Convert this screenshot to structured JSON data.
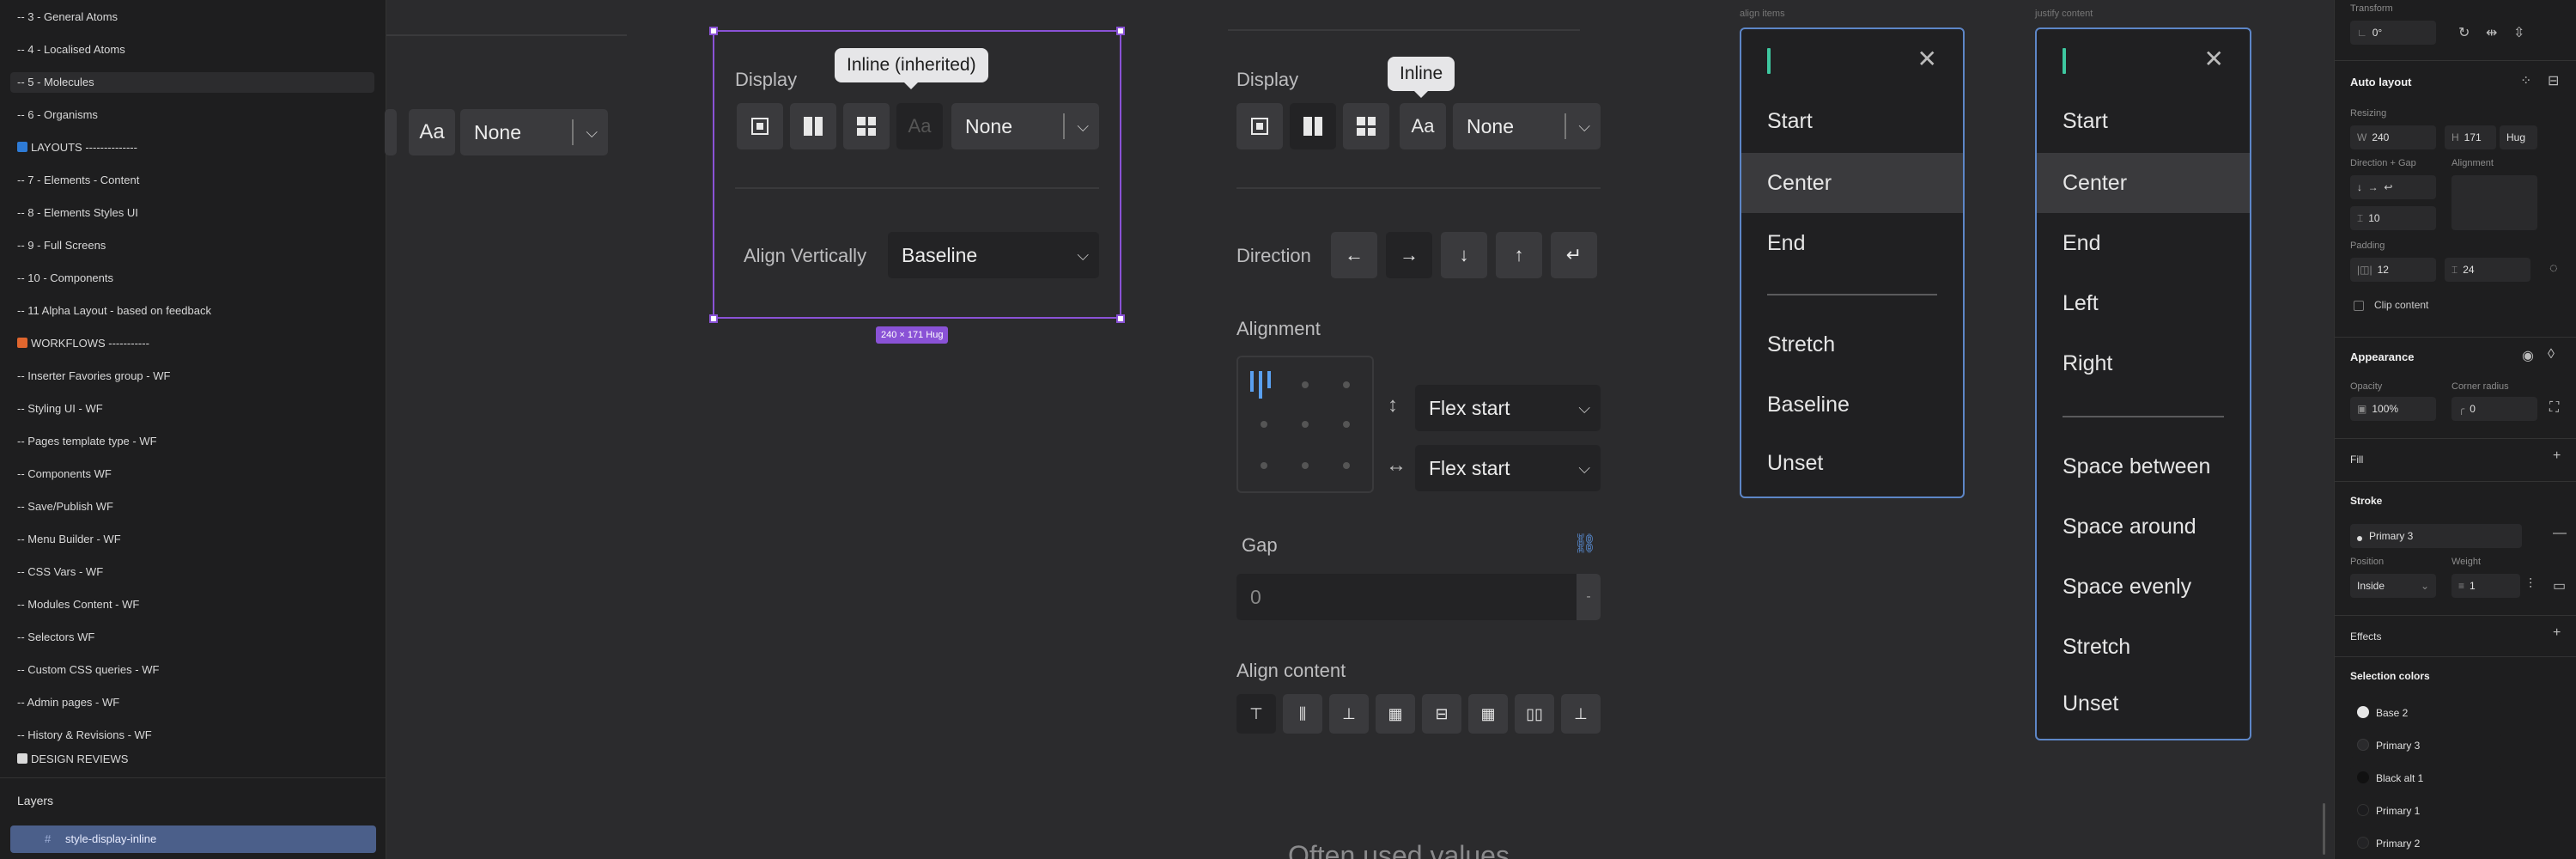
{
  "left_panel": {
    "pages": [
      {
        "label": "-- 3 - General Atoms"
      },
      {
        "label": "-- 4 - Localised Atoms"
      },
      {
        "label": "-- 5 - Molecules"
      },
      {
        "label": "-- 6 - Organisms"
      },
      {
        "label": "LAYOUTS --------------"
      },
      {
        "label": "-- 7 - Elements - Content"
      },
      {
        "label": "-- 8 - Elements Styles UI"
      },
      {
        "label": "-- 9 - Full Screens"
      },
      {
        "label": "-- 10 - Components"
      },
      {
        "label": "-- 11 Alpha Layout - based on feedback"
      },
      {
        "label": "WORKFLOWS -----------"
      },
      {
        "label": "-- Inserter Favories group - WF"
      },
      {
        "label": "-- Styling UI - WF"
      },
      {
        "label": "-- Pages template type - WF"
      },
      {
        "label": "-- Components WF"
      },
      {
        "label": "-- Save/Publish WF"
      },
      {
        "label": "-- Menu Builder - WF"
      },
      {
        "label": "-- CSS Vars - WF"
      },
      {
        "label": "-- Modules Content - WF"
      },
      {
        "label": "-- Selectors WF"
      },
      {
        "label": "-- Custom CSS queries - WF"
      },
      {
        "label": "-- Admin pages - WF"
      },
      {
        "label": "-- History & Revisions - WF"
      },
      {
        "label": "DESIGN REVIEWS"
      }
    ],
    "layers_label": "Layers",
    "selected_layer": "style-display-inline",
    "colors": {
      "layouts_icon": "#2e7bd6",
      "workflows_icon": "#e0662e",
      "design_icon": "#d9d9d9"
    }
  },
  "canvas": {
    "left_partial": {
      "aa": "Aa",
      "none": "None"
    },
    "frame1": {
      "display_label": "Display",
      "tooltip": "Inline (inherited)",
      "aa": "Aa",
      "none": "None",
      "align_label": "Align Vertically",
      "align_value": "Baseline",
      "size_badge": "240 × 171 Hug"
    },
    "frame2": {
      "display_label": "Display",
      "tooltip": "Inline",
      "aa": "Aa",
      "none": "None",
      "direction_label": "Direction",
      "alignment_label": "Alignment",
      "flex1": "Flex start",
      "flex2": "Flex start",
      "gap_label": "Gap",
      "gap_value": "0",
      "gap_unit": "-",
      "align_content_label": "Align content"
    },
    "align_items_dd": {
      "caption": "align items",
      "items": [
        "Start",
        "Center",
        "End",
        "Stretch",
        "Baseline",
        "Unset"
      ]
    },
    "justify_dd": {
      "caption": "justify content",
      "items": [
        "Start",
        "Center",
        "End",
        "Left",
        "Right",
        "Space between",
        "Space around",
        "Space evenly",
        "Stretch",
        "Unset"
      ]
    },
    "bottom_heading": "Often used values"
  },
  "right_panel": {
    "transform": "Transform",
    "rotation": "0°",
    "auto_layout": "Auto layout",
    "resizing": "Resizing",
    "w_label": "W",
    "w_value": "240",
    "h_label": "H",
    "h_value": "171",
    "hug": "Hug",
    "direction_gap": "Direction + Gap",
    "alignment": "Alignment",
    "gap_value": "10",
    "padding": "Padding",
    "pad_h": "12",
    "pad_v": "24",
    "clip": "Clip content",
    "appearance": "Appearance",
    "opacity_label": "Opacity",
    "radius_label": "Corner radius",
    "opacity": "100%",
    "radius": "0",
    "fill": "Fill",
    "stroke": "Stroke",
    "stroke_value": "Primary 3",
    "position_label": "Position",
    "weight_label": "Weight",
    "position_value": "Inside",
    "weight_value": "1",
    "effects": "Effects",
    "selection_colors": "Selection colors",
    "swatches": [
      {
        "name": "Base 2",
        "color": "#e6e6e6"
      },
      {
        "name": "Primary 3",
        "color": "#2a2a2c"
      },
      {
        "name": "Black alt 1",
        "color": "#111111"
      },
      {
        "name": "Primary 1",
        "color": "#1c1c1e"
      },
      {
        "name": "Primary 2",
        "color": "#232325"
      }
    ]
  }
}
